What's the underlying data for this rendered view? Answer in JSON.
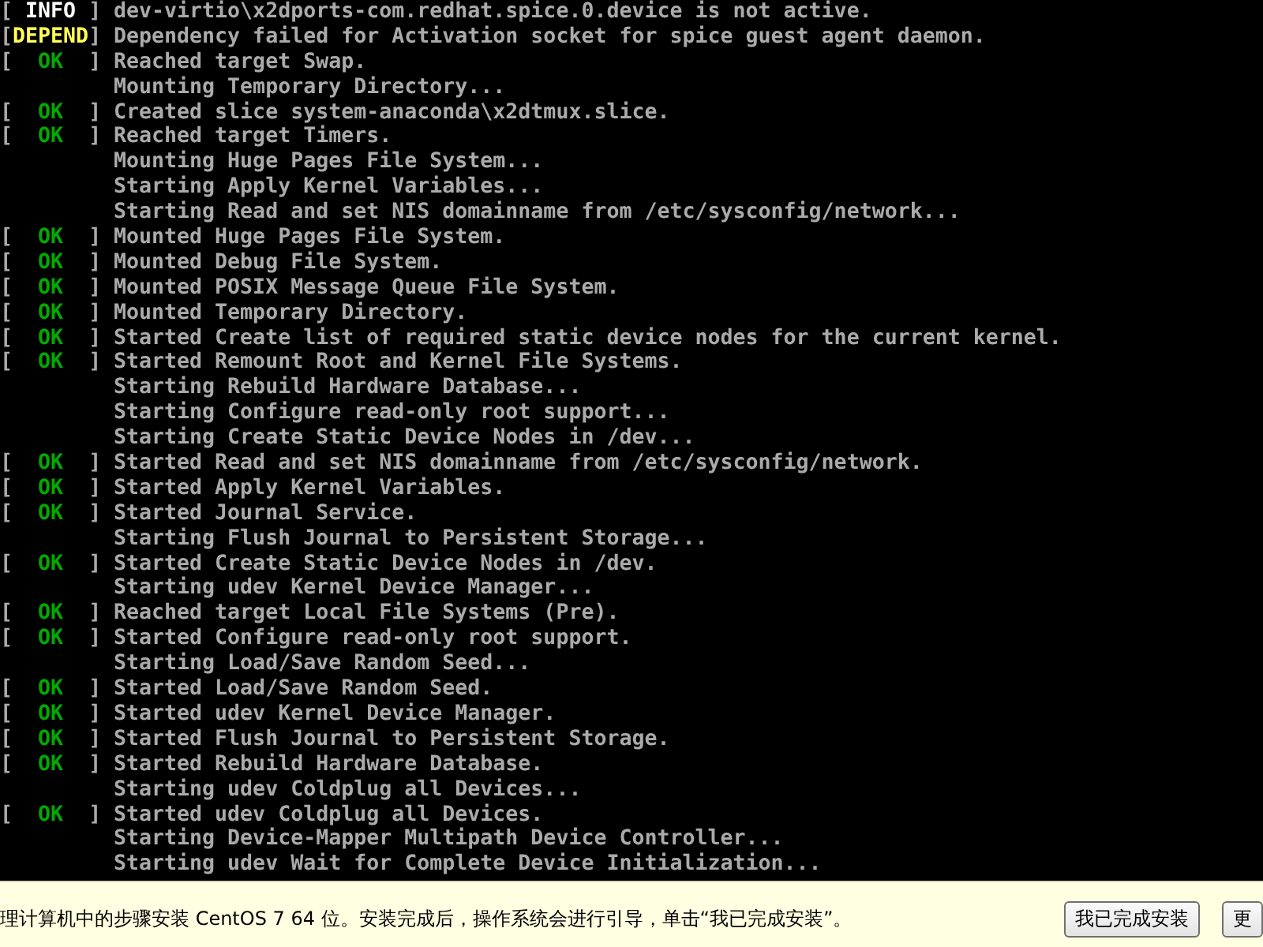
{
  "console": {
    "lines": [
      {
        "kind": "info",
        "status": "[ INFO ]",
        "text": "dev-virtio\\x2dports-com.redhat.spice.0.device is not active."
      },
      {
        "kind": "depend",
        "status": "[DEPEND]",
        "text": "Dependency failed for Activation socket for spice guest agent daemon."
      },
      {
        "kind": "ok",
        "status": "[  OK  ]",
        "text": "Reached target Swap."
      },
      {
        "kind": "plain",
        "text": "Mounting Temporary Directory..."
      },
      {
        "kind": "ok",
        "status": "[  OK  ]",
        "text": "Created slice system-anaconda\\x2dtmux.slice."
      },
      {
        "kind": "ok",
        "status": "[  OK  ]",
        "text": "Reached target Timers."
      },
      {
        "kind": "plain",
        "text": "Mounting Huge Pages File System..."
      },
      {
        "kind": "plain",
        "text": "Starting Apply Kernel Variables..."
      },
      {
        "kind": "plain",
        "text": "Starting Read and set NIS domainname from /etc/sysconfig/network..."
      },
      {
        "kind": "ok",
        "status": "[  OK  ]",
        "text": "Mounted Huge Pages File System."
      },
      {
        "kind": "ok",
        "status": "[  OK  ]",
        "text": "Mounted Debug File System."
      },
      {
        "kind": "ok",
        "status": "[  OK  ]",
        "text": "Mounted POSIX Message Queue File System."
      },
      {
        "kind": "ok",
        "status": "[  OK  ]",
        "text": "Mounted Temporary Directory."
      },
      {
        "kind": "ok",
        "status": "[  OK  ]",
        "text": "Started Create list of required static device nodes for the current kernel."
      },
      {
        "kind": "ok",
        "status": "[  OK  ]",
        "text": "Started Remount Root and Kernel File Systems."
      },
      {
        "kind": "plain",
        "text": "Starting Rebuild Hardware Database..."
      },
      {
        "kind": "plain",
        "text": "Starting Configure read-only root support..."
      },
      {
        "kind": "plain",
        "text": "Starting Create Static Device Nodes in /dev..."
      },
      {
        "kind": "ok",
        "status": "[  OK  ]",
        "text": "Started Read and set NIS domainname from /etc/sysconfig/network."
      },
      {
        "kind": "ok",
        "status": "[  OK  ]",
        "text": "Started Apply Kernel Variables."
      },
      {
        "kind": "ok",
        "status": "[  OK  ]",
        "text": "Started Journal Service."
      },
      {
        "kind": "plain",
        "text": "Starting Flush Journal to Persistent Storage..."
      },
      {
        "kind": "ok",
        "status": "[  OK  ]",
        "text": "Started Create Static Device Nodes in /dev."
      },
      {
        "kind": "plain",
        "text": "Starting udev Kernel Device Manager..."
      },
      {
        "kind": "ok",
        "status": "[  OK  ]",
        "text": "Reached target Local File Systems (Pre)."
      },
      {
        "kind": "ok",
        "status": "[  OK  ]",
        "text": "Started Configure read-only root support."
      },
      {
        "kind": "plain",
        "text": "Starting Load/Save Random Seed..."
      },
      {
        "kind": "ok",
        "status": "[  OK  ]",
        "text": "Started Load/Save Random Seed."
      },
      {
        "kind": "ok",
        "status": "[  OK  ]",
        "text": "Started udev Kernel Device Manager."
      },
      {
        "kind": "ok",
        "status": "[  OK  ]",
        "text": "Started Flush Journal to Persistent Storage."
      },
      {
        "kind": "ok",
        "status": "[  OK  ]",
        "text": "Started Rebuild Hardware Database."
      },
      {
        "kind": "plain",
        "text": "Starting udev Coldplug all Devices..."
      },
      {
        "kind": "ok",
        "status": "[  OK  ]",
        "text": "Started udev Coldplug all Devices."
      },
      {
        "kind": "plain",
        "text": "Starting Device-Mapper Multipath Device Controller..."
      },
      {
        "kind": "plain",
        "text": "Starting udev Wait for Complete Device Initialization..."
      }
    ]
  },
  "hint_bar": {
    "text": "理计算机中的步骤安装 CentOS 7 64 位。安装完成后，操作系统会进行引导，单击“我已完成安装”。",
    "buttons": [
      "我已完成安装",
      "更"
    ]
  }
}
